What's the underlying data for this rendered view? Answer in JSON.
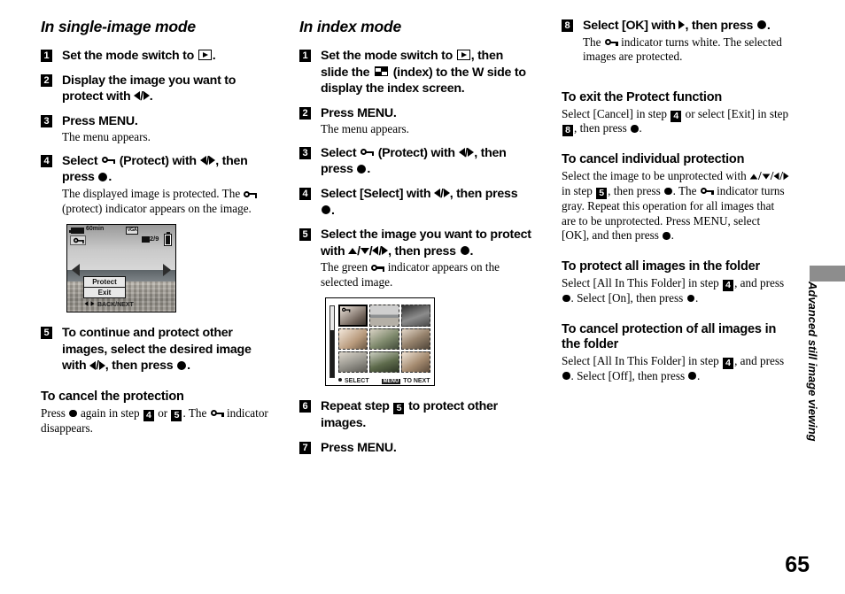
{
  "page_number": "65",
  "side_tab_label": "Advanced still image viewing",
  "col1": {
    "heading": "In single-image mode",
    "steps": [
      {
        "num": "1",
        "text_a": "Set the mode switch to ",
        "text_b": "."
      },
      {
        "num": "2",
        "text_a": "Display the image you want to protect with ",
        "text_b": "."
      },
      {
        "num": "3",
        "text_a": "Press MENU.",
        "note": "The menu appears."
      },
      {
        "num": "4",
        "text_a": "Select ",
        "text_b": " (Protect) with ",
        "text_c": ", then press ",
        "text_d": ".",
        "note_a": "The displayed image is protected. The ",
        "note_b": " (protect) indicator appears on the image."
      },
      {
        "num": "5",
        "text_a": "To continue and protect other images, select the desired image with ",
        "text_b": ", then press ",
        "text_c": "."
      }
    ],
    "subhead": "To cancel the protection",
    "cancel_a": "Press ",
    "cancel_b": " again in step ",
    "cancel_step1": "4",
    "cancel_c": " or ",
    "cancel_step2": "5",
    "cancel_d": ". The ",
    "cancel_e": " indicator disappears.",
    "lcd": {
      "rec_time": "60min",
      "quality": "VGA",
      "counter": "2/9",
      "menu_item_1": "Protect",
      "menu_item_2": "Exit",
      "footer": "BACK/NEXT"
    }
  },
  "col2": {
    "heading": "In index mode",
    "steps": [
      {
        "num": "1",
        "text_a": "Set the mode switch to ",
        "text_b": ", then slide the ",
        "text_c": " (index) to the W side to display the index screen."
      },
      {
        "num": "2",
        "text_a": "Press MENU.",
        "note": "The menu appears."
      },
      {
        "num": "3",
        "text_a": "Select ",
        "text_b": " (Protect) with ",
        "text_c": ", then press ",
        "text_d": "."
      },
      {
        "num": "4",
        "text_a": "Select [Select] with ",
        "text_b": ", then press ",
        "text_c": "."
      },
      {
        "num": "5",
        "text_a": "Select the image you want to protect with ",
        "text_b": ", then press ",
        "text_c": ".",
        "note_a": "The green ",
        "note_b": " indicator appears on the selected image."
      },
      {
        "num": "6",
        "text_a": "Repeat step ",
        "step_ref": "5",
        "text_b": " to protect other images."
      },
      {
        "num": "7",
        "text_a": "Press MENU."
      }
    ],
    "index_lcd": {
      "select_label": "SELECT",
      "menu_label": "MENU",
      "next_label": "TO NEXT"
    }
  },
  "col3": {
    "step8": {
      "num": "8",
      "text_a": "Select [OK] with ",
      "text_b": ", then press ",
      "text_c": ".",
      "note_a": "The ",
      "note_b": " indicator turns white. The selected images are protected."
    },
    "sections": [
      {
        "title": "To exit the Protect function",
        "body_a": "Select [Cancel] in step ",
        "ref1": "4",
        "body_b": " or select [Exit] in step ",
        "ref2": "8",
        "body_c": ", then press ",
        "body_d": "."
      },
      {
        "title": "To cancel individual protection",
        "body_a": "Select the image to be unprotected with ",
        "body_b": " in step ",
        "ref1": "5",
        "body_c": ", then press ",
        "body_d": ". The ",
        "body_e": " indicator turns gray. Repeat this operation for all images that are to be unprotected. Press MENU, select [OK], and then press ",
        "body_f": "."
      },
      {
        "title": "To protect all images in the folder",
        "body_a": "Select [All In This Folder] in step ",
        "ref1": "4",
        "body_b": ", and press ",
        "body_c": ". Select [On], then press ",
        "body_d": "."
      },
      {
        "title": "To cancel protection of all images in the folder",
        "body_a": "Select [All In This Folder] in step ",
        "ref1": "4",
        "body_b": ", and press ",
        "body_c": ". Select [Off], then press ",
        "body_d": "."
      }
    ]
  }
}
